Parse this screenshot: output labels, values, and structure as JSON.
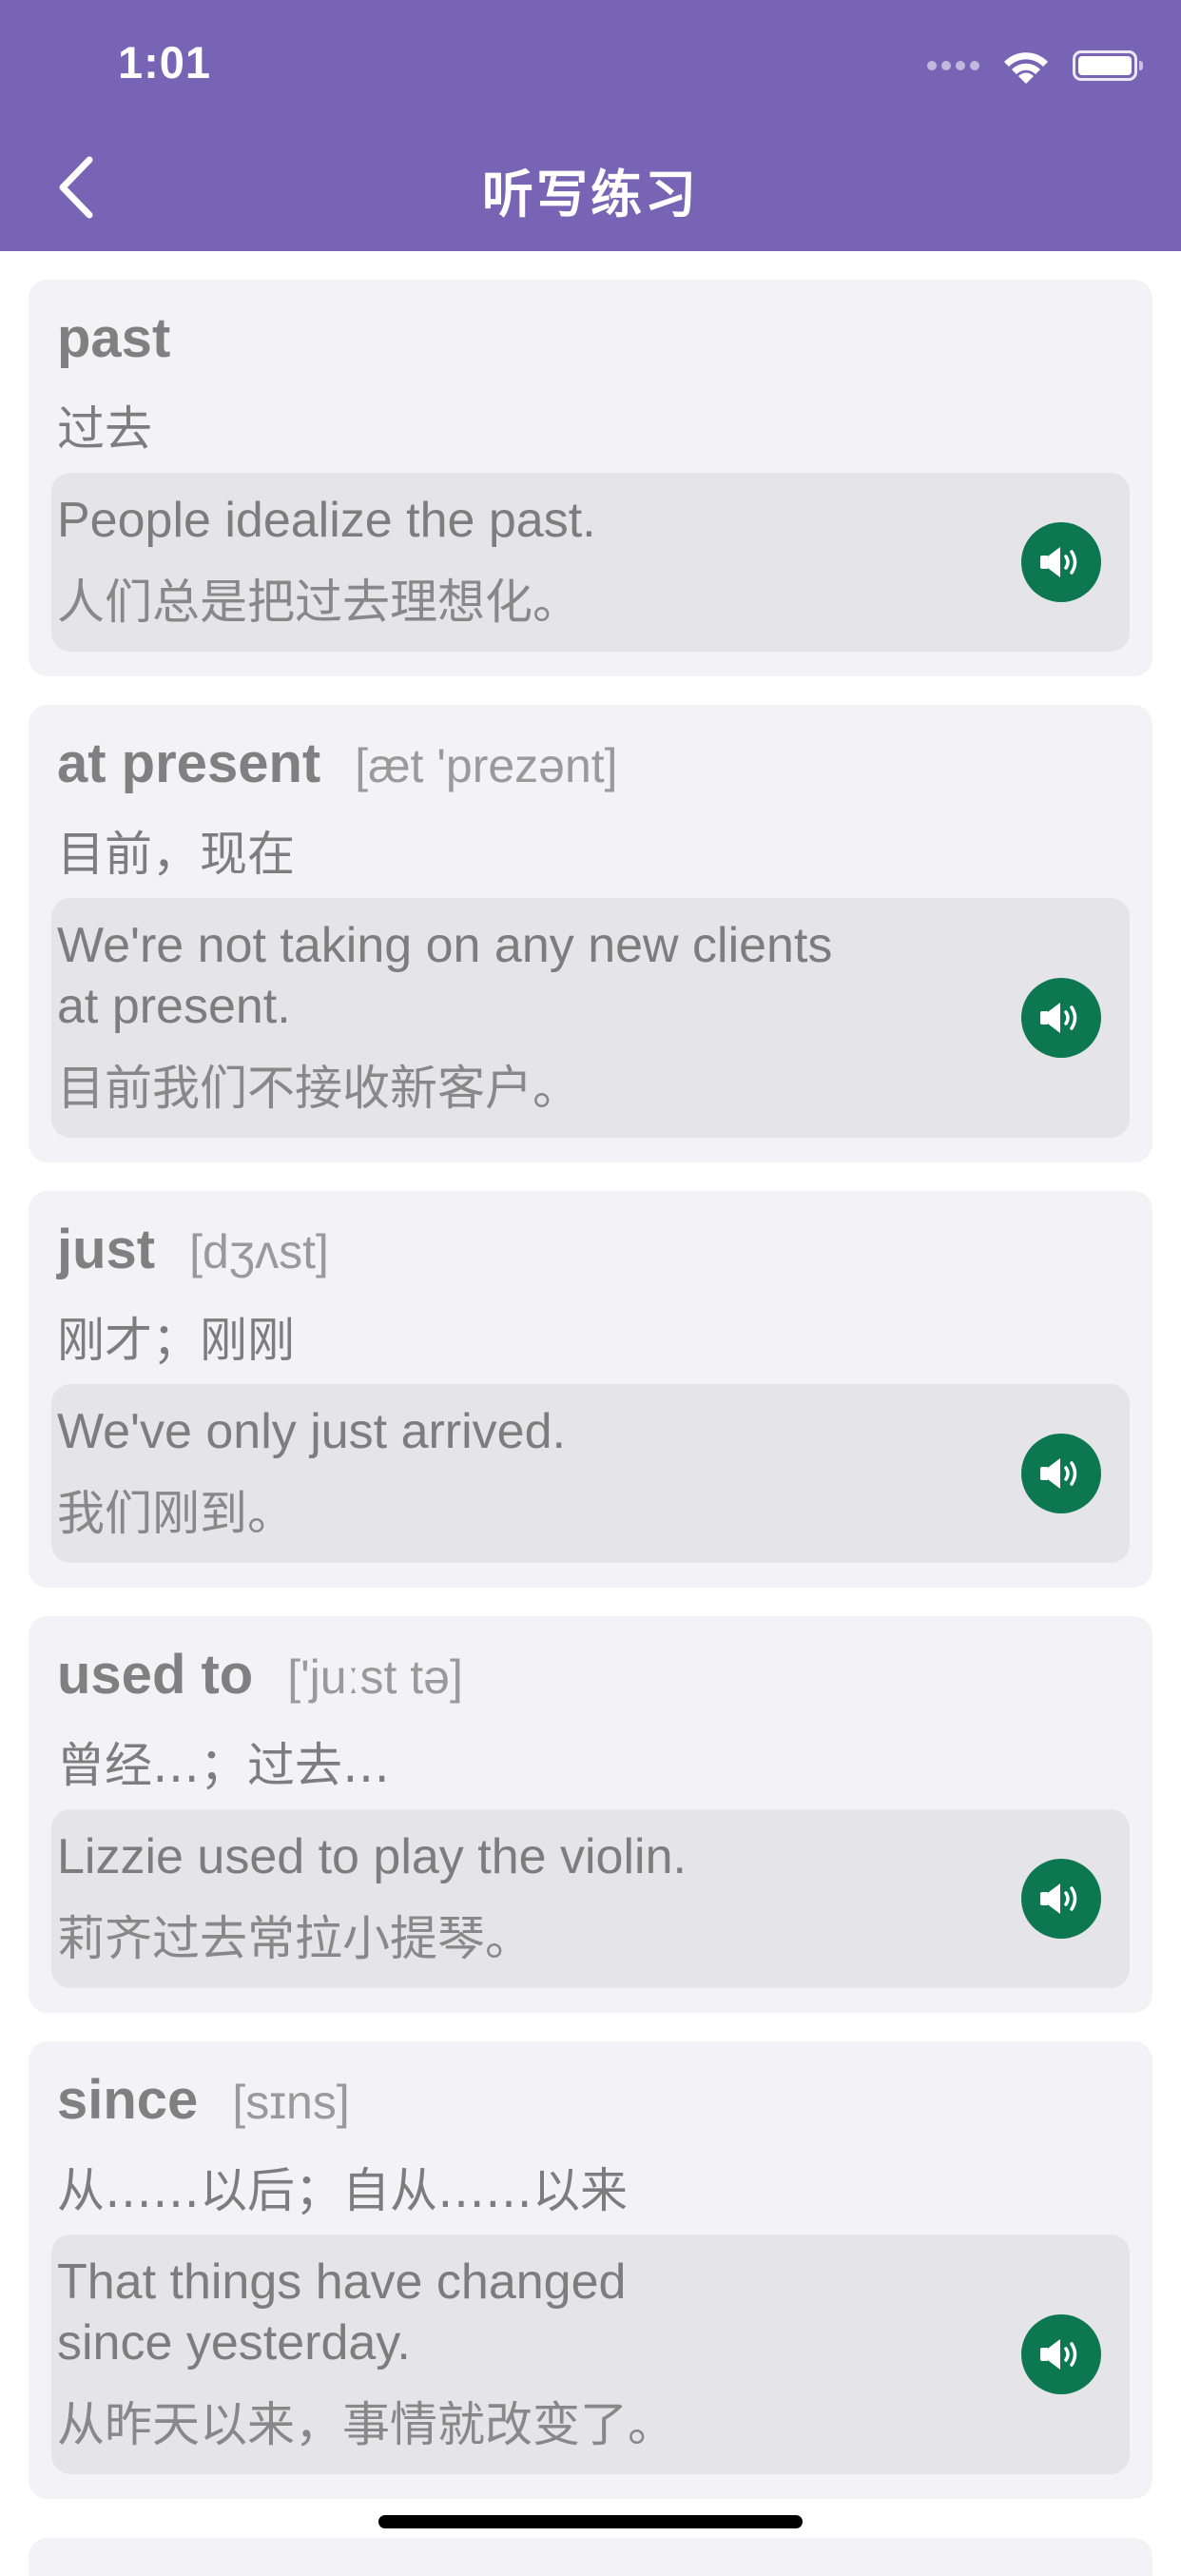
{
  "status_bar": {
    "time": "1:01"
  },
  "nav": {
    "title": "听写练习",
    "back_icon": "chevron-left-icon"
  },
  "colors": {
    "header_bg": "#7764b4",
    "card_bg": "#f2f2f7",
    "example_bg": "#e4e4e9",
    "speaker_bg": "#0c7750"
  },
  "words": [
    {
      "word": "past",
      "phonetic": "",
      "meaning": "过去",
      "example_en": "People idealize the past.",
      "example_zh": "人们总是把过去理想化。"
    },
    {
      "word": "at present",
      "phonetic": "[æt 'prezənt]",
      "meaning": "目前，现在",
      "example_en": "We're not taking on any new clients at present.",
      "example_zh": "目前我们不接收新客户。"
    },
    {
      "word": "just",
      "phonetic": "[dʒʌst]",
      "meaning": "刚才；刚刚",
      "example_en": "We've only just arrived.",
      "example_zh": "我们刚到。"
    },
    {
      "word": "used to",
      "phonetic": "['juːst tə]",
      "meaning": "曾经…；过去…",
      "example_en": "Lizzie used to play the violin.",
      "example_zh": "莉齐过去常拉小提琴。"
    },
    {
      "word": "since",
      "phonetic": "[sɪns]",
      "meaning": "从……以后；自从……以来",
      "example_en": "That things have changed since yesterday.",
      "example_zh": "从昨天以来，事情就改变了。"
    }
  ]
}
